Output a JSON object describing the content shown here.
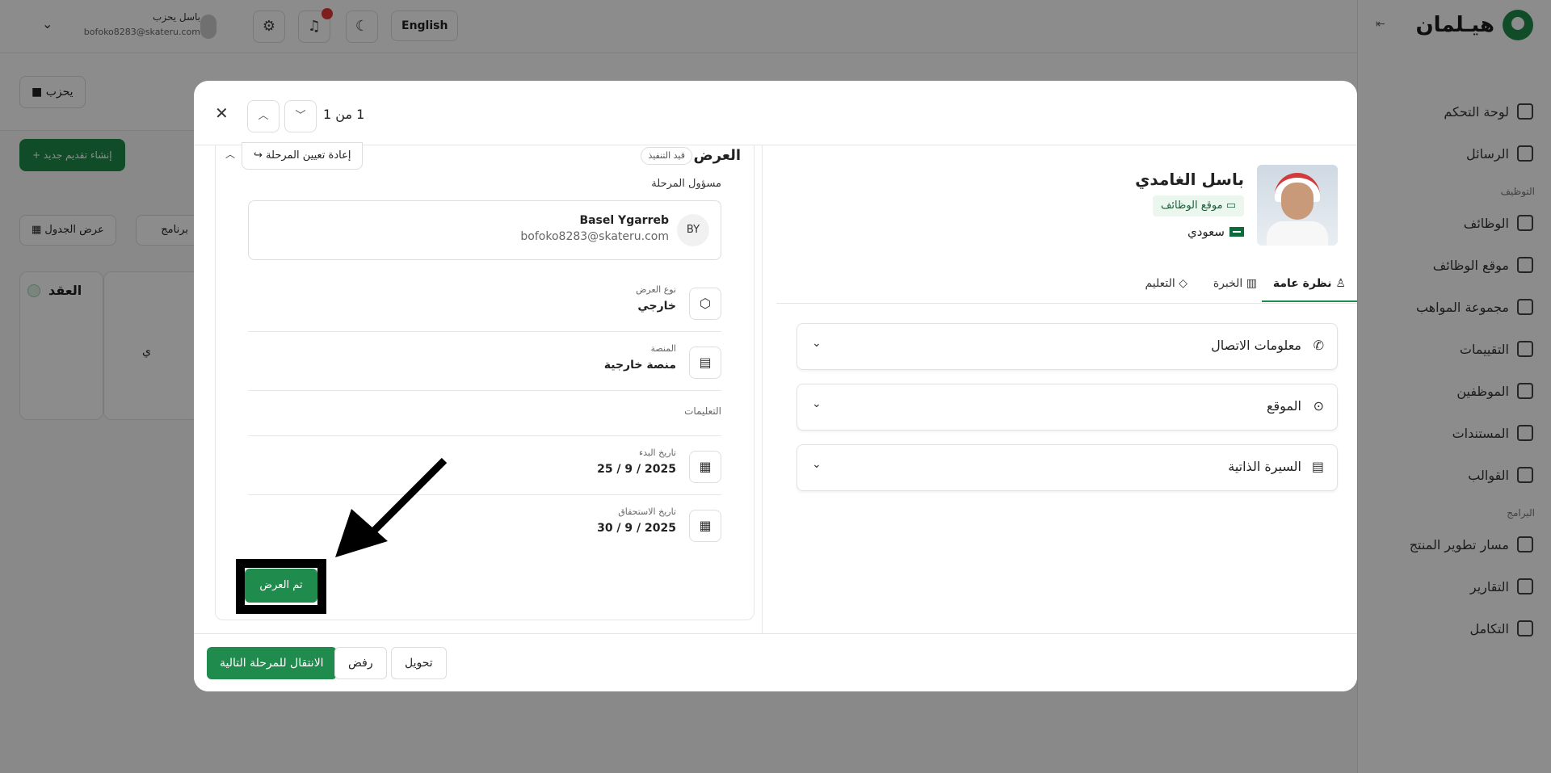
{
  "app": {
    "logo_text": "هيـلمان",
    "user_name": "باسل يحزب",
    "user_email": "bofoko8283@skateru.com",
    "language": "English",
    "party_button": "يحزب",
    "new_application_button": "إنشاء تقديم جديد",
    "table_view_button": "عرض الجدول",
    "new_program_button": "برنامج جديد",
    "kanban_column": "العقد",
    "kanban_card_text": "ي"
  },
  "sidebar": {
    "items": [
      {
        "label": "لوحة التحكم",
        "icon": "dashboard-icon"
      },
      {
        "label": "الرسائل",
        "icon": "mail-icon"
      }
    ],
    "section_employment": "التوظيف",
    "employment_items": [
      {
        "label": "الوظائف",
        "icon": "briefcase-icon"
      },
      {
        "label": "موقع الوظائف",
        "icon": "laptop-icon"
      },
      {
        "label": "مجموعة المواهب",
        "icon": "talent-icon"
      },
      {
        "label": "التقييمات",
        "icon": "table-icon"
      },
      {
        "label": "الموظفين",
        "icon": "user-icon"
      },
      {
        "label": "المستندات",
        "icon": "file-icon"
      },
      {
        "label": "القوالب",
        "icon": "template-icon"
      }
    ],
    "section_programs": "البرامج",
    "program_items": [
      {
        "label": "مسار تطوير المنتج",
        "icon": "fire-icon"
      },
      {
        "label": "التقارير",
        "icon": "chart-icon"
      },
      {
        "label": "التكامل",
        "icon": "link-icon"
      }
    ]
  },
  "modal": {
    "page_count": "1 من 1",
    "stage": {
      "title": "العرض",
      "status_badge": "قيد التنفيذ",
      "reassign_button": "إعادة تعيين المرحلة",
      "owner_label": "مسؤول المرحلة",
      "owner": {
        "initials": "BY",
        "name": "Basel Ygarreb",
        "email": "bofoko8283@skateru.com"
      },
      "fields": [
        {
          "label": "نوع العرض",
          "value": "خارجي",
          "icon": "settings-icon"
        },
        {
          "label": "المنصة",
          "value": "منصة خارجية",
          "icon": "clipboard-icon"
        }
      ],
      "instructions_label": "التعليمات",
      "dates": [
        {
          "label": "تاريخ البدء",
          "value": "25 / 9 / 2025",
          "icon": "calendar-icon"
        },
        {
          "label": "تاريخ الاستحقاق",
          "value": "30 / 9 / 2025",
          "icon": "calendar-icon"
        }
      ],
      "done_button": "تم العرض"
    },
    "candidate": {
      "name": "باسل الغامدي",
      "source": "موقع الوظائف",
      "nationality": "سعودي"
    },
    "tabs": [
      {
        "label": "نظرة عامة",
        "active": true
      },
      {
        "label": "الخبرة",
        "active": false
      },
      {
        "label": "التعليم",
        "active": false
      }
    ],
    "accordions": [
      {
        "title": "معلومات الاتصال",
        "icon": "phone-icon"
      },
      {
        "title": "الموقع",
        "icon": "location-icon"
      },
      {
        "title": "السيرة الذاتية",
        "icon": "document-icon"
      }
    ],
    "footer": {
      "next_stage_button": "الانتقال للمرحلة التالية",
      "reject_button": "رفض",
      "transfer_button": "تحويل"
    }
  },
  "colors": {
    "primary": "#1f8b4c",
    "overlay": "#000000"
  }
}
